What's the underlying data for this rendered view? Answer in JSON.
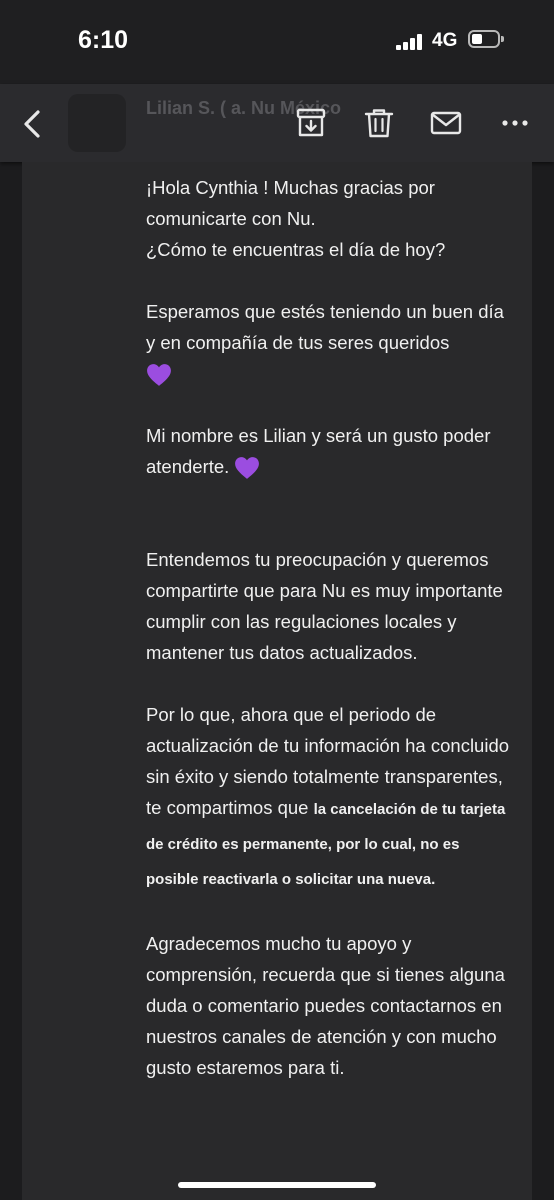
{
  "status_bar": {
    "time": "6:10",
    "network": "4G"
  },
  "toolbar": {
    "sender": "Lilian S. ( a. Nu México",
    "sender_sub": ""
  },
  "colors": {
    "heart": "#9b4de0",
    "background": "#1c1c1e",
    "panel": "#29292b"
  },
  "icons": [
    "back-arrow-icon",
    "archive-icon",
    "trash-icon",
    "mail-icon",
    "more-icon",
    "purple-heart-icon"
  ],
  "email": {
    "p1_line1": "¡Hola Cynthia ! Muchas gracias por comunicarte con Nu.",
    "p1_line2": "¿Cómo te encuentras el día de hoy?",
    "p2": "Esperamos que estés teniendo un buen día y en compañía de tus seres queridos",
    "p3": "Mi nombre es Lilian y será un gusto poder atenderte.",
    "p4": "Entendemos tu preocupación y queremos compartirte que para Nu es muy importante cumplir con las regulaciones locales y mantener tus datos actualizados.",
    "p5_normal": "Por lo que, ahora que el periodo de actualización de tu información ha concluido sin éxito y siendo totalmente transparentes, te compartimos que",
    "p5_bold": "la cancelación de tu tarjeta de crédito es permanente, por lo cual, no es posible reactivarla o solicitar una nueva.",
    "p6": "Agradecemos mucho tu apoyo y comprensión, recuerda que si tienes alguna duda o comentario puedes contactarnos en nuestros canales de atención y con mucho gusto estaremos para ti."
  }
}
